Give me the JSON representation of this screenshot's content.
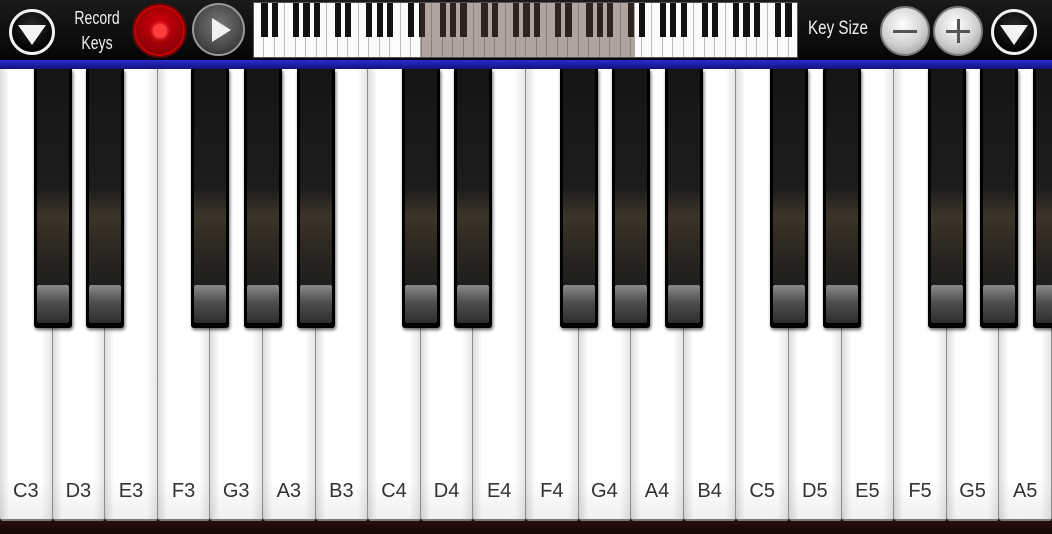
{
  "toolbar": {
    "record_label": "Record\nKeys",
    "keysize_label": "Key Size",
    "left_menu_icon": "chevron-down-icon",
    "right_menu_icon": "chevron-down-icon",
    "record_icon": "record-icon",
    "play_icon": "play-icon",
    "minus_icon": "minus-icon",
    "plus_icon": "plus-icon",
    "colors": {
      "record_red": "#d8000a",
      "accent_blue": "#2a2acf"
    }
  },
  "keyboard": {
    "white_keys": [
      "C3",
      "D3",
      "E3",
      "F3",
      "G3",
      "A3",
      "B3",
      "C4",
      "D4",
      "E4",
      "F4",
      "G4",
      "A4",
      "B4",
      "C5",
      "D5",
      "E5",
      "F5",
      "G5",
      "A5"
    ],
    "has_black_after": [
      true,
      true,
      false,
      true,
      true,
      true,
      false,
      true,
      true,
      false,
      true,
      true,
      true,
      false,
      true,
      true,
      false,
      true,
      true,
      true
    ]
  },
  "overview": {
    "visible_range_start": 0.305,
    "visible_range_end": 0.7
  }
}
